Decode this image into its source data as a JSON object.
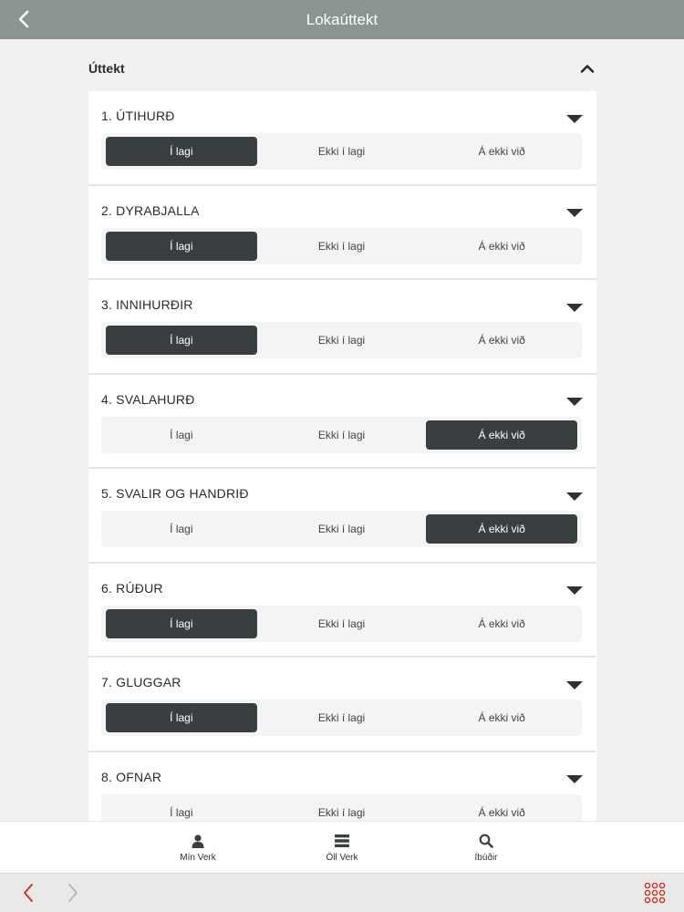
{
  "header": {
    "title": "Lokaúttekt",
    "back_icon": "chevron-left-icon"
  },
  "section": {
    "label": "Úttekt",
    "toggle_icon": "chevron-up-icon"
  },
  "options": [
    "Í lagi",
    "Ekki í lagi",
    "Á ekki við"
  ],
  "items": [
    {
      "name": "1. ÚTIHURÐ",
      "selected": 0
    },
    {
      "name": "2. DYRABJALLA",
      "selected": 0
    },
    {
      "name": "3. INNIHURÐIR",
      "selected": 0
    },
    {
      "name": "4. SVALAHURÐ",
      "selected": 2
    },
    {
      "name": "5. SVALIR OG HANDRIÐ",
      "selected": 2
    },
    {
      "name": "6. RÚÐUR",
      "selected": 0
    },
    {
      "name": "7. GLUGGAR",
      "selected": 0
    },
    {
      "name": "8. OFNAR",
      "selected": null
    }
  ],
  "tabs": [
    {
      "label": "Mín Verk",
      "icon": "user-icon"
    },
    {
      "label": "Öll Verk",
      "icon": "list-icon"
    },
    {
      "label": "Íbúðir",
      "icon": "search-icon"
    }
  ],
  "browser": {
    "back_icon": "browser-back-icon",
    "forward_icon": "browser-forward-icon",
    "menu_icon": "grid-menu-icon"
  },
  "colors": {
    "header": "#8a9590",
    "selected": "#393e40",
    "accent": "#c0392b"
  }
}
